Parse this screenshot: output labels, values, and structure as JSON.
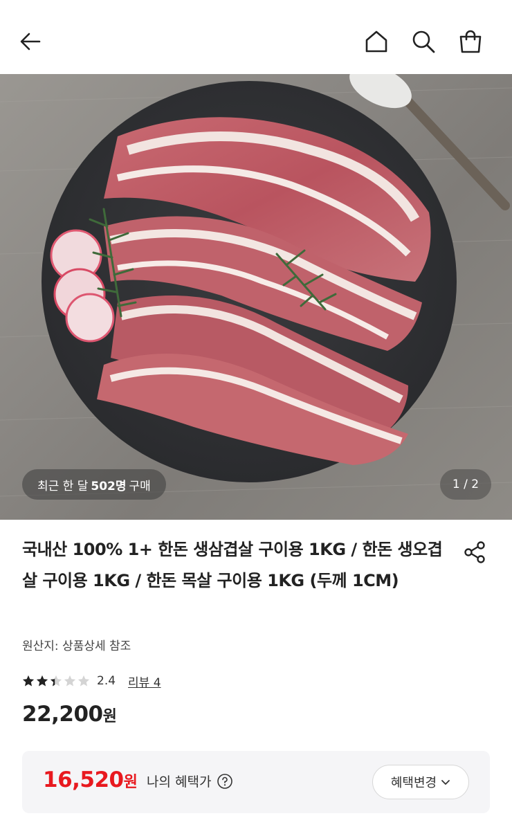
{
  "header": {
    "back_icon": "arrow-left-icon",
    "home_icon": "home-icon",
    "search_icon": "search-icon",
    "cart_icon": "shopping-bag-icon"
  },
  "hero": {
    "buyers_prefix": "최근 한 달",
    "buyers_count": "502명",
    "buyers_suffix": "구매",
    "page_indicator": "1 / 2"
  },
  "product": {
    "title": "국내산 100% 1+ 한돈 생삼겹살 구이용 1KG / 한돈 생오겹살 구이용 1KG / 한돈 목살 구이용 1KG (두께 1CM)",
    "share_icon": "share-icon",
    "origin": "원산지: 상품상세 참조",
    "rating_value": "2.4",
    "rating_fraction": 0.48,
    "review_label": "리뷰 4",
    "price_amount": "22,200",
    "price_unit": "원"
  },
  "benefit": {
    "price_amount": "16,520",
    "price_unit": "원",
    "label": "나의 혜택가",
    "help_icon": "question-circle-icon",
    "change_button": "혜택변경",
    "change_icon": "chevron-down-icon",
    "accent_color": "#e8191f"
  }
}
